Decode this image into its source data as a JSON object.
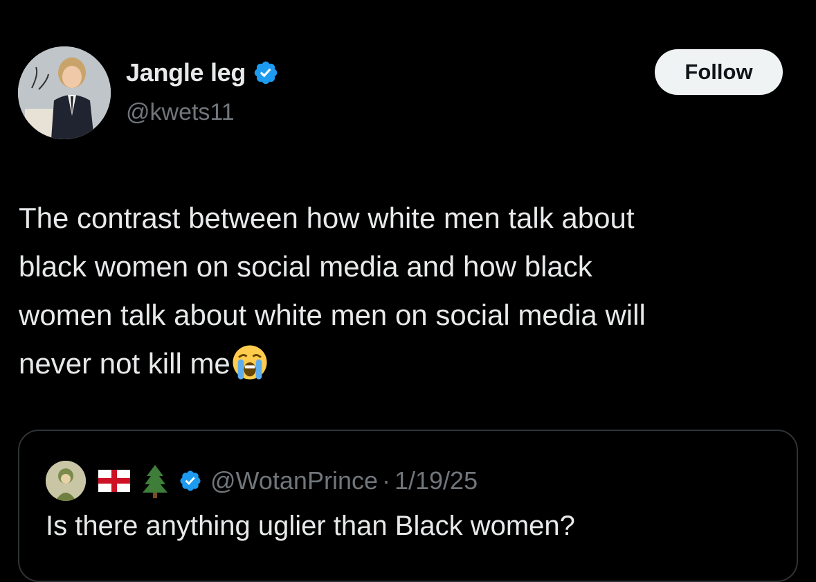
{
  "author": {
    "display_name": "Jangle leg",
    "handle": "@kwets11",
    "verified": true,
    "avatar_icon": "profile-photo-man-at-podium"
  },
  "follow_button": {
    "label": "Follow"
  },
  "tweet": {
    "text": "The contrast between how white men talk about\nblack women on social media and how black\nwomen talk about white men on social media will\nnever not kill me",
    "emoji_icon": "loudly-crying-face-emoji"
  },
  "quoted_tweet": {
    "avatar_icon": "cartoon-avatar",
    "badges": [
      "england-flag-icon",
      "evergreen-tree-icon"
    ],
    "verified": true,
    "handle": "@WotanPrince",
    "separator": "·",
    "date": "1/19/25",
    "text": "Is there anything uglier than Black women?"
  },
  "colors": {
    "background": "#000000",
    "primary_text": "#e7e9ea",
    "secondary_text": "#71767b",
    "verified_blue": "#1d9bf0",
    "border": "#2f3336",
    "follow_bg": "#eff3f4"
  }
}
